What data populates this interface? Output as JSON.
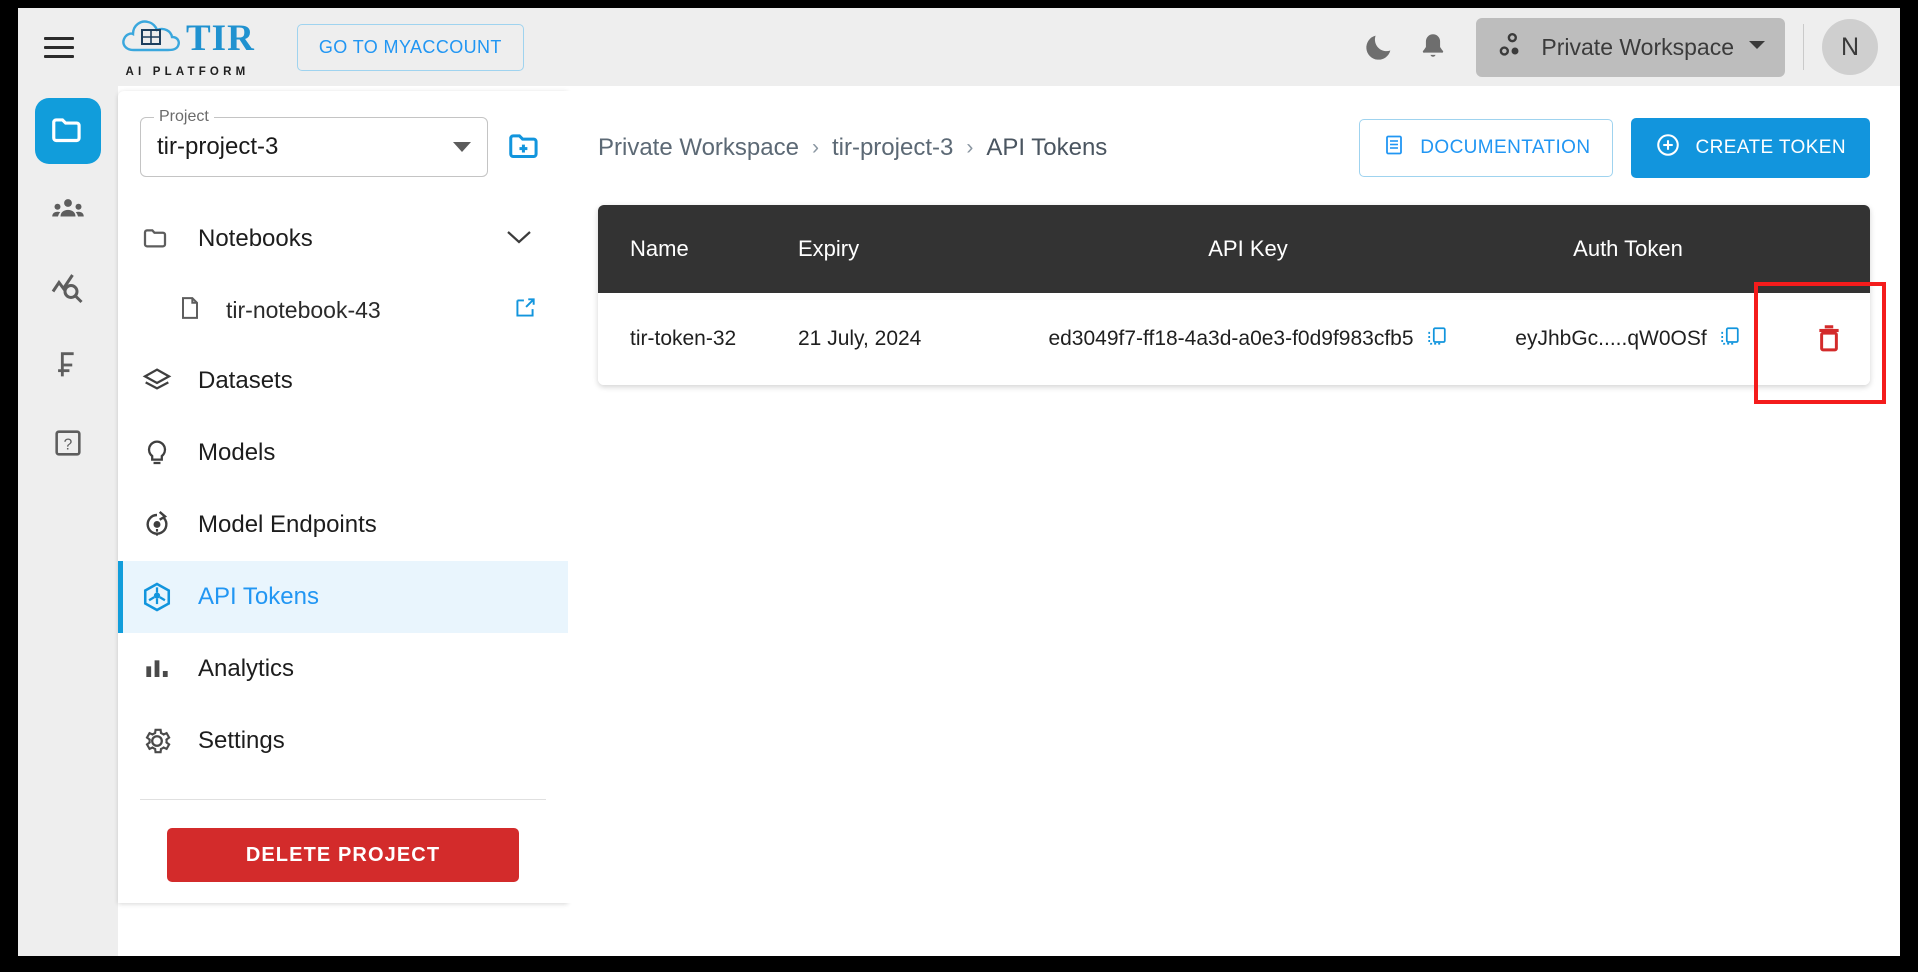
{
  "header": {
    "menu_icon": "hamburger-icon",
    "logo_text": "TIR",
    "logo_subtitle": "AI PLATFORM",
    "myaccount_label": "GO TO MYACCOUNT",
    "theme_icon": "moon-icon",
    "notification_icon": "bell-icon",
    "workspace_label": "Private Workspace",
    "workspace_icon": "workspace-nodes-icon",
    "avatar_initial": "N"
  },
  "rail": {
    "items": [
      {
        "name": "projects",
        "icon": "folder-icon",
        "active": true
      },
      {
        "name": "team",
        "icon": "people-icon",
        "active": false
      },
      {
        "name": "monitoring",
        "icon": "chart-search-icon",
        "active": false
      },
      {
        "name": "billing",
        "icon": "franc-icon",
        "active": false
      },
      {
        "name": "help",
        "icon": "question-box-icon",
        "active": false
      }
    ]
  },
  "sidebar": {
    "project_label": "Project",
    "project_value": "tir-project-3",
    "new_project_icon": "folder-plus-icon",
    "nav": [
      {
        "label": "Notebooks",
        "icon": "folder-outline-icon",
        "active": false,
        "expandable": true
      },
      {
        "label": "tir-notebook-43",
        "icon": "file-icon",
        "active": false,
        "sub": true,
        "external": true
      },
      {
        "label": "Datasets",
        "icon": "layers-icon",
        "active": false
      },
      {
        "label": "Models",
        "icon": "bulb-icon",
        "active": false
      },
      {
        "label": "Model Endpoints",
        "icon": "endpoint-icon",
        "active": false
      },
      {
        "label": "API Tokens",
        "icon": "cube-icon",
        "active": true
      },
      {
        "label": "Analytics",
        "icon": "bar-chart-icon",
        "active": false
      },
      {
        "label": "Settings",
        "icon": "gear-icon",
        "active": false
      }
    ],
    "delete_project_label": "DELETE PROJECT"
  },
  "content": {
    "breadcrumb": [
      "Private Workspace",
      "tir-project-3",
      "API Tokens"
    ],
    "breadcrumb_separator": "›",
    "documentation_label": "DOCUMENTATION",
    "documentation_icon": "doc-icon",
    "create_token_label": "CREATE TOKEN",
    "create_token_icon": "plus-circle-icon"
  },
  "table": {
    "columns": [
      "Name",
      "Expiry",
      "API Key",
      "Auth Token",
      ""
    ],
    "rows": [
      {
        "name": "tir-token-32",
        "expiry": "21 July, 2024",
        "api_key": "ed3049f7-ff18-4a3d-a0e3-f0d9f983cfb5",
        "auth_token": "eyJhbGc.....qW0OSf",
        "copy_icon": "copy-icon",
        "delete_icon": "trash-icon"
      }
    ]
  },
  "colors": {
    "accent": "#1295dd",
    "danger": "#d32b2b",
    "highlight": "#f41c1c",
    "table_header_bg": "#333333",
    "active_nav_bg": "#e9f5fd"
  }
}
